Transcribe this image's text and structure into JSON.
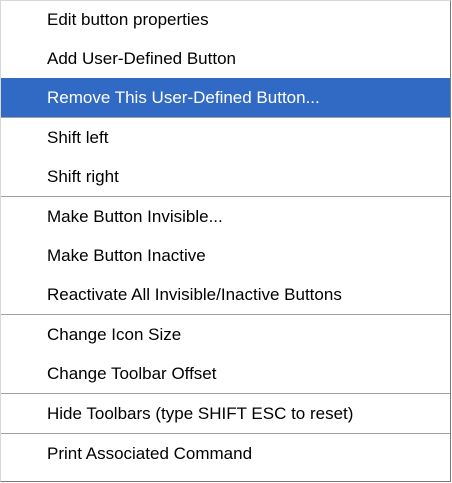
{
  "context_menu": {
    "highlight_color": "#316ac5",
    "groups": [
      {
        "items": [
          {
            "label": "Edit button properties"
          },
          {
            "label": "Add User-Defined Button"
          },
          {
            "label": "Remove This User-Defined Button...",
            "highlighted": true
          }
        ]
      },
      {
        "items": [
          {
            "label": "Shift left"
          },
          {
            "label": "Shift right"
          }
        ]
      },
      {
        "items": [
          {
            "label": "Make Button Invisible..."
          },
          {
            "label": "Make Button Inactive"
          },
          {
            "label": "Reactivate All Invisible/Inactive Buttons"
          }
        ]
      },
      {
        "items": [
          {
            "label": "Change Icon Size"
          },
          {
            "label": "Change Toolbar Offset"
          }
        ]
      },
      {
        "items": [
          {
            "label": "Hide Toolbars (type SHIFT ESC to reset)"
          }
        ]
      },
      {
        "items": [
          {
            "label": "Print Associated Command"
          }
        ]
      }
    ]
  }
}
